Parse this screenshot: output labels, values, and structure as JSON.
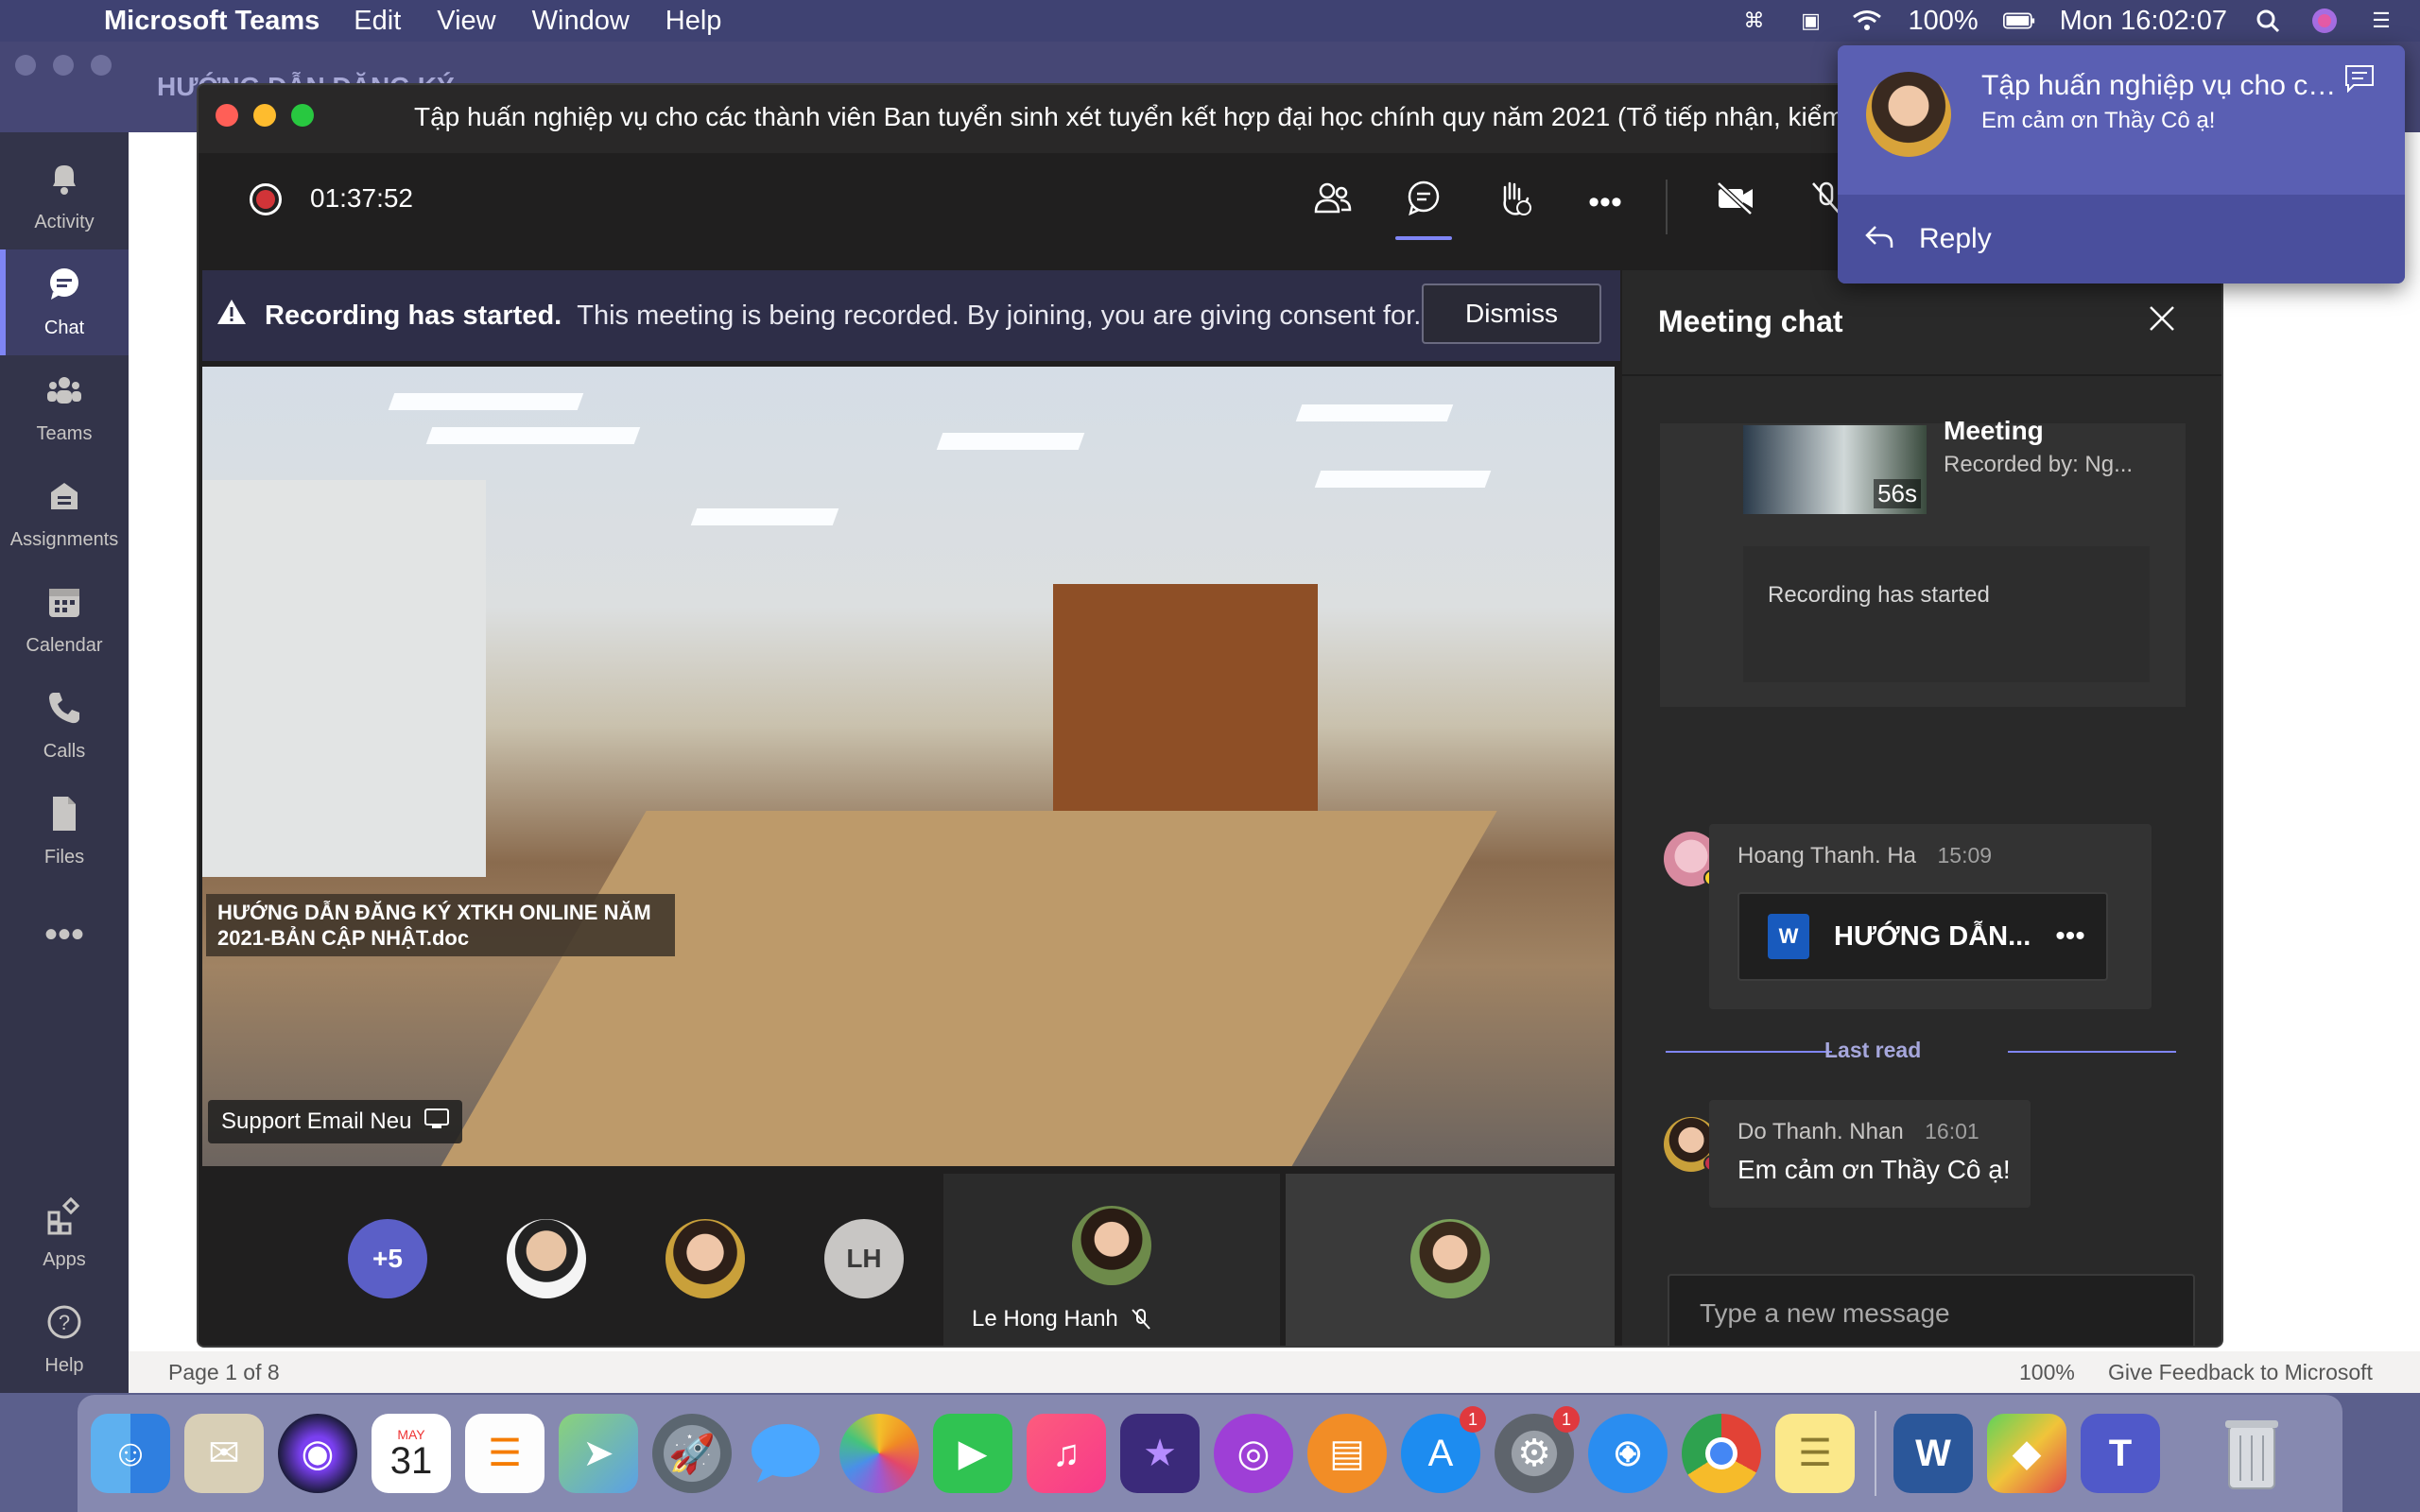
{
  "menubar": {
    "app_name": "Microsoft Teams",
    "menus": [
      "Edit",
      "View",
      "Window",
      "Help"
    ],
    "battery": "100%",
    "clock": "Mon 16:02:07"
  },
  "background_window": {
    "title": "HƯỚNG DẪN ĐĂNG KÝ",
    "status_page": "Page 1 of 8",
    "status_zoom": "100%",
    "status_feedback": "Give Feedback to Microsoft"
  },
  "rail": {
    "items": [
      {
        "label": "Activity",
        "icon": "bell-icon"
      },
      {
        "label": "Chat",
        "icon": "chat-icon"
      },
      {
        "label": "Teams",
        "icon": "teams-icon"
      },
      {
        "label": "Assignments",
        "icon": "assignments-icon"
      },
      {
        "label": "Calendar",
        "icon": "calendar-icon"
      },
      {
        "label": "Calls",
        "icon": "phone-icon"
      },
      {
        "label": "Files",
        "icon": "file-icon"
      },
      {
        "label": "Apps",
        "icon": "apps-icon"
      },
      {
        "label": "Help",
        "icon": "help-icon"
      }
    ],
    "active": "Chat"
  },
  "meeting": {
    "title": "Tập huấn nghiệp vụ cho các thành viên Ban tuyển sinh xét tuyển kết hợp đại học chính quy năm 2021 (Tổ tiếp nhận, kiểm",
    "timer": "01:37:52",
    "banner": {
      "title": "Recording has started.",
      "text": "This meeting is being recorded. By joining, you are giving consent for...",
      "dismiss_label": "Dismiss"
    },
    "video": {
      "caption": "HƯỚNG DẪN ĐĂNG KÝ XTKH ONLINE NĂM 2021-BẢN CẬP NHẬT.doc",
      "presenter": "Support Email Neu"
    },
    "participants": {
      "overflow": "+5",
      "initials": "LH",
      "spotlight_name": "Le Hong Hanh"
    }
  },
  "chat": {
    "title": "Meeting chat",
    "recording_card": {
      "name": "Meeting",
      "recorded_by": "Recorded by: Ng...",
      "duration": "56s",
      "status": "Recording has started"
    },
    "messages": [
      {
        "author": "Hoang Thanh. Ha",
        "time": "15:09",
        "file": "HƯỚNG DẪN..."
      },
      {
        "author": "Do Thanh. Nhan",
        "time": "16:01",
        "text": "Em cảm ơn Thầy Cô ạ!"
      }
    ],
    "last_read": "Last read",
    "input_placeholder": "Type a new message"
  },
  "toast": {
    "title": "Tập huấn nghiệp vụ cho cá...",
    "message": "Em cảm ơn Thầy Cô ạ!",
    "reply_label": "Reply"
  },
  "dock": {
    "calendar_month": "MAY",
    "calendar_day": "31",
    "badges": {
      "app_store": "1",
      "system_prefs": "1"
    },
    "colors": {
      "accent": "#7f85f5",
      "record": "#d13438",
      "menubar": "#3f4272"
    }
  }
}
